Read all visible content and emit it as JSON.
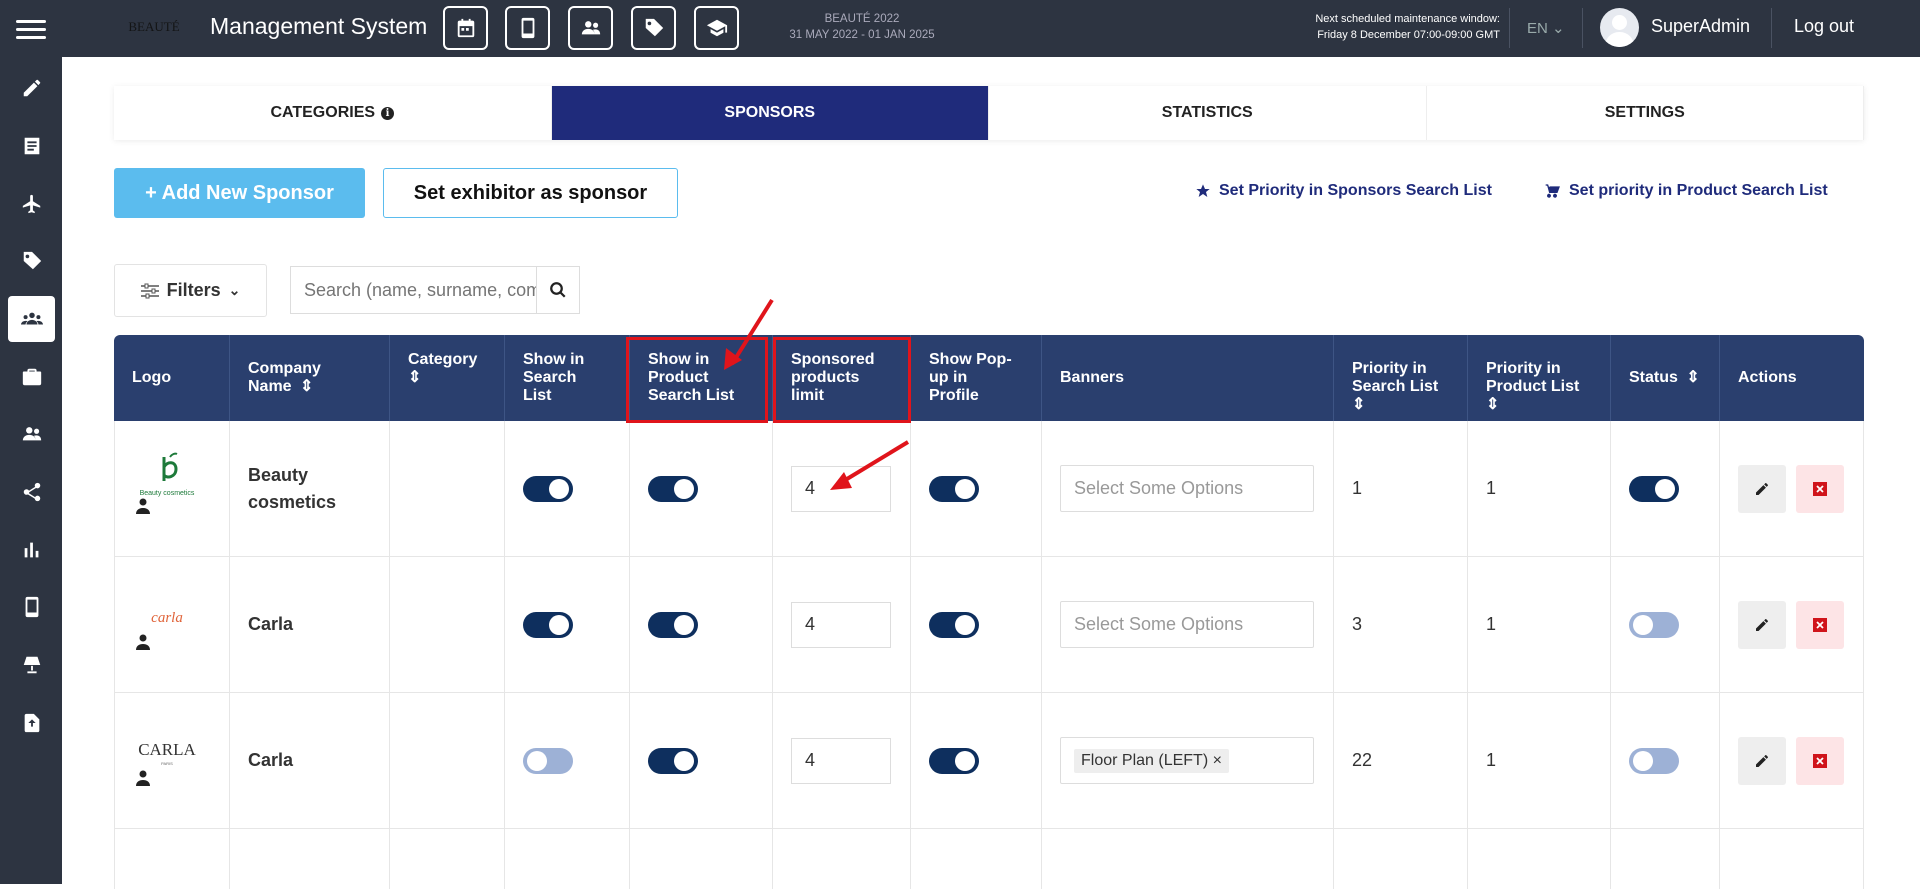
{
  "header": {
    "logo_text": "BEAUTÉ",
    "title": "Management System",
    "event_name": "BEAUTÉ 2022",
    "event_dates": "31 MAY 2022 - 01 JAN 2025",
    "maintenance_line1": "Next scheduled maintenance window:",
    "maintenance_line2": "Friday 8 December 07:00-09:00 GMT",
    "language": "EN",
    "user": "SuperAdmin",
    "logout": "Log out",
    "toolbar_icons": [
      "calendar-icon",
      "mobile-icon",
      "users-icon",
      "tag-icon",
      "graduation-cap-icon"
    ]
  },
  "sidebar_icons": [
    "pencil-icon",
    "list-icon",
    "plane-icon",
    "tags-icon",
    "sponsors-icon",
    "briefcase-icon",
    "users-icon",
    "share-icon",
    "bar-chart-icon",
    "mobile-icon",
    "lamp-icon",
    "upload-file-icon"
  ],
  "tabs": [
    {
      "label": "CATEGORIES",
      "active": false
    },
    {
      "label": "SPONSORS",
      "active": true
    },
    {
      "label": "STATISTICS",
      "active": false
    },
    {
      "label": "SETTINGS",
      "active": false
    }
  ],
  "actions": {
    "add_sponsor": "+ Add New Sponsor",
    "set_exhibitor": "Set exhibitor as sponsor",
    "priority_sponsors": "Set Priority in Sponsors Search List",
    "priority_products": "Set priority in Product Search List"
  },
  "filters": {
    "label": "Filters",
    "search_placeholder": "Search (name, surname, company...)"
  },
  "table": {
    "headers": {
      "logo": "Logo",
      "company_l1": "Company",
      "company_l2": "Name",
      "category": "Category",
      "search_l1": "Show in",
      "search_l2": "Search",
      "search_l3": "List",
      "product_l1": "Show in",
      "product_l2": "Product",
      "product_l3": "Search List",
      "limit_l1": "Sponsored",
      "limit_l2": "products",
      "limit_l3": "limit",
      "popup_l1": "Show Pop-",
      "popup_l2": "up in",
      "popup_l3": "Profile",
      "banners": "Banners",
      "prio_search_l1": "Priority in",
      "prio_search_l2": "Search List",
      "prio_product_l1": "Priority in",
      "prio_product_l2": "Product List",
      "status": "Status",
      "actions": "Actions"
    },
    "rows": [
      {
        "logo": "Beauty cosmetics",
        "company": "Beauty cosmetics",
        "category": "",
        "show_search": true,
        "show_product": true,
        "limit": "4",
        "show_popup": true,
        "banners_placeholder": "Select Some Options",
        "banner_chip": "",
        "prio_search": "1",
        "prio_product": "1",
        "status": true
      },
      {
        "logo": "carla",
        "company": "Carla",
        "category": "",
        "show_search": true,
        "show_product": true,
        "limit": "4",
        "show_popup": true,
        "banners_placeholder": "Select Some Options",
        "banner_chip": "",
        "prio_search": "3",
        "prio_product": "1",
        "status": false
      },
      {
        "logo": "CARLA",
        "logo_sub": "PARIS",
        "company": "Carla",
        "category": "",
        "show_search": false,
        "show_product": true,
        "limit": "4",
        "show_popup": true,
        "banners_placeholder": "",
        "banner_chip": "Floor Plan (LEFT)",
        "prio_search": "22",
        "prio_product": "1",
        "status": false
      }
    ]
  },
  "colors": {
    "topbar": "#2d3441",
    "active_tab": "#1f2b7b",
    "table_header": "#2a3f6e",
    "toggle_on": "#0e2f5e",
    "toggle_off": "#9db1d6",
    "add_button": "#5bbcee",
    "highlight": "#e0141b"
  }
}
